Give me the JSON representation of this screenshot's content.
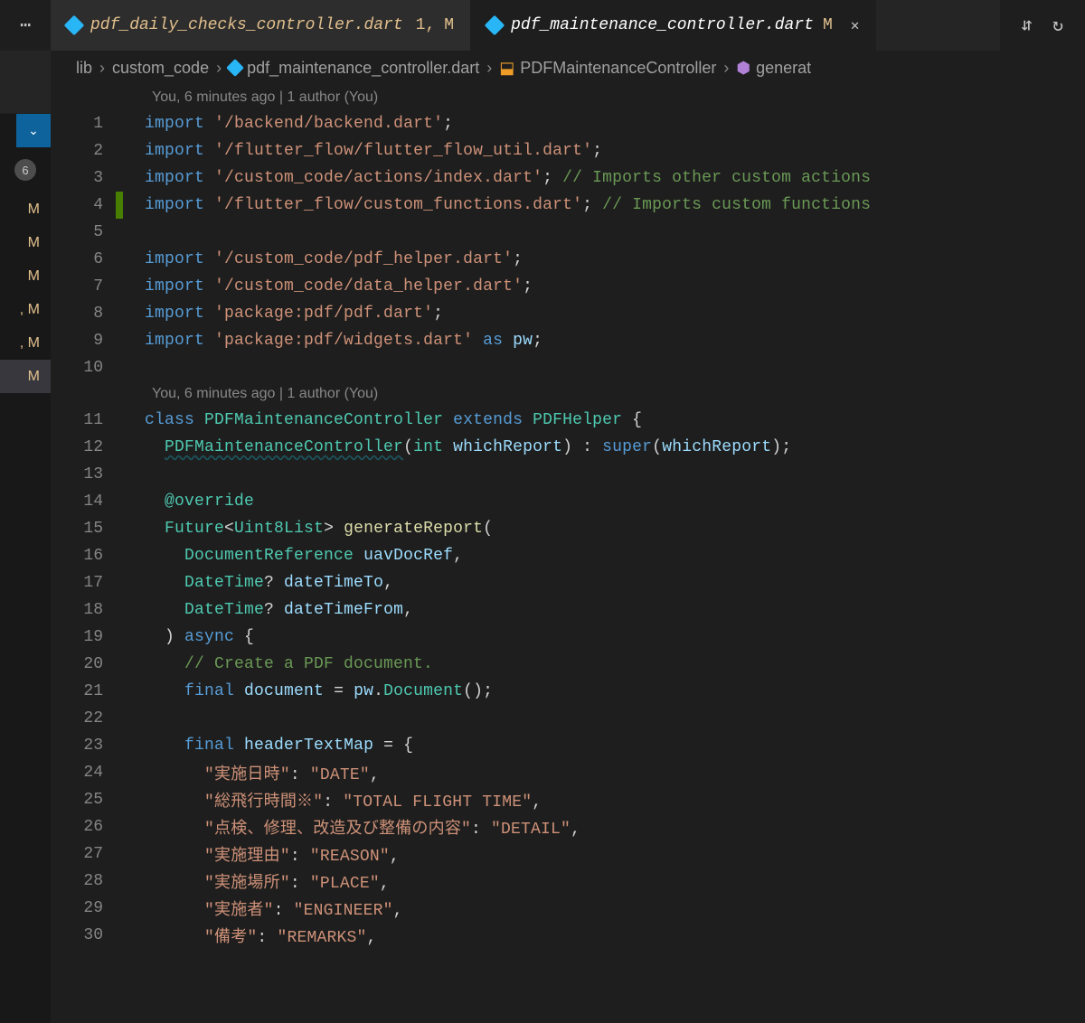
{
  "tabs": [
    {
      "name": "pdf_daily_checks_controller.dart",
      "problems": "1,",
      "modified": "M"
    },
    {
      "name": "pdf_maintenance_controller.dart",
      "modified": "M"
    }
  ],
  "breadcrumb": {
    "seg0": "lib",
    "seg1": "custom_code",
    "seg2": "pdf_maintenance_controller.dart",
    "seg3": "PDFMaintenanceController",
    "seg4": "generat"
  },
  "leftStrip": {
    "badge": "6",
    "items": [
      "M",
      "M",
      "M",
      ", M",
      ", M",
      "M"
    ]
  },
  "codelens": {
    "top": "You, 6 minutes ago | 1 author (You)",
    "mid": "You, 6 minutes ago | 1 author (You)"
  },
  "lines": [
    {
      "n": 1,
      "seg": [
        [
          "k",
          "import"
        ],
        [
          "p",
          " "
        ],
        [
          "s",
          "'/backend/backend.dart'"
        ],
        [
          "p",
          ";"
        ]
      ]
    },
    {
      "n": 2,
      "seg": [
        [
          "k",
          "import"
        ],
        [
          "p",
          " "
        ],
        [
          "s",
          "'/flutter_flow/flutter_flow_util.dart'"
        ],
        [
          "p",
          ";"
        ]
      ]
    },
    {
      "n": 3,
      "seg": [
        [
          "k",
          "import"
        ],
        [
          "p",
          " "
        ],
        [
          "s",
          "'/custom_code/actions/index.dart'"
        ],
        [
          "p",
          "; "
        ],
        [
          "c",
          "// Imports other custom actions"
        ]
      ]
    },
    {
      "n": 4,
      "mod": true,
      "seg": [
        [
          "k",
          "import"
        ],
        [
          "p",
          " "
        ],
        [
          "s",
          "'/flutter_flow/custom_functions.dart'"
        ],
        [
          "p",
          "; "
        ],
        [
          "c",
          "// Imports custom functions"
        ]
      ]
    },
    {
      "n": 5,
      "seg": []
    },
    {
      "n": 6,
      "seg": [
        [
          "k",
          "import"
        ],
        [
          "p",
          " "
        ],
        [
          "s",
          "'/custom_code/pdf_helper.dart'"
        ],
        [
          "p",
          ";"
        ]
      ]
    },
    {
      "n": 7,
      "seg": [
        [
          "k",
          "import"
        ],
        [
          "p",
          " "
        ],
        [
          "s",
          "'/custom_code/data_helper.dart'"
        ],
        [
          "p",
          ";"
        ]
      ]
    },
    {
      "n": 8,
      "seg": [
        [
          "k",
          "import"
        ],
        [
          "p",
          " "
        ],
        [
          "s",
          "'package:pdf/pdf.dart'"
        ],
        [
          "p",
          ";"
        ]
      ]
    },
    {
      "n": 9,
      "seg": [
        [
          "k",
          "import"
        ],
        [
          "p",
          " "
        ],
        [
          "s",
          "'package:pdf/widgets.dart'"
        ],
        [
          "p",
          " "
        ],
        [
          "k",
          "as"
        ],
        [
          "p",
          " "
        ],
        [
          "v",
          "pw"
        ],
        [
          "p",
          ";"
        ]
      ]
    },
    {
      "n": 10,
      "seg": []
    },
    {
      "n": 11,
      "seg": [
        [
          "k",
          "class"
        ],
        [
          "p",
          " "
        ],
        [
          "t",
          "PDFMaintenanceController"
        ],
        [
          "p",
          " "
        ],
        [
          "k",
          "extends"
        ],
        [
          "p",
          " "
        ],
        [
          "t",
          "PDFHelper"
        ],
        [
          "p",
          " {"
        ]
      ]
    },
    {
      "n": 12,
      "seg": [
        [
          "p",
          "  "
        ],
        [
          "t warn",
          "PDFMaintenanceController"
        ],
        [
          "p",
          "("
        ],
        [
          "t",
          "int"
        ],
        [
          "p",
          " "
        ],
        [
          "v",
          "whichReport"
        ],
        [
          "p",
          ") : "
        ],
        [
          "k",
          "super"
        ],
        [
          "p",
          "("
        ],
        [
          "v",
          "whichReport"
        ],
        [
          "p",
          ");"
        ]
      ]
    },
    {
      "n": 13,
      "seg": []
    },
    {
      "n": 14,
      "seg": [
        [
          "p",
          "  "
        ],
        [
          "anno",
          "@override"
        ]
      ]
    },
    {
      "n": 15,
      "seg": [
        [
          "p",
          "  "
        ],
        [
          "t",
          "Future"
        ],
        [
          "p",
          "<"
        ],
        [
          "t",
          "Uint8List"
        ],
        [
          "p",
          "> "
        ],
        [
          "f",
          "generateReport"
        ],
        [
          "p",
          "("
        ]
      ]
    },
    {
      "n": 16,
      "seg": [
        [
          "p",
          "    "
        ],
        [
          "t",
          "DocumentReference"
        ],
        [
          "p",
          " "
        ],
        [
          "v",
          "uavDocRef"
        ],
        [
          "p",
          ","
        ]
      ]
    },
    {
      "n": 17,
      "seg": [
        [
          "p",
          "    "
        ],
        [
          "t",
          "DateTime"
        ],
        [
          "p",
          "? "
        ],
        [
          "v",
          "dateTimeTo"
        ],
        [
          "p",
          ","
        ]
      ]
    },
    {
      "n": 18,
      "seg": [
        [
          "p",
          "    "
        ],
        [
          "t",
          "DateTime"
        ],
        [
          "p",
          "? "
        ],
        [
          "v",
          "dateTimeFrom"
        ],
        [
          "p",
          ","
        ]
      ]
    },
    {
      "n": 19,
      "seg": [
        [
          "p",
          "  ) "
        ],
        [
          "k",
          "async"
        ],
        [
          "p",
          " {"
        ]
      ]
    },
    {
      "n": 20,
      "seg": [
        [
          "p",
          "    "
        ],
        [
          "c",
          "// Create a PDF document."
        ]
      ]
    },
    {
      "n": 21,
      "seg": [
        [
          "p",
          "    "
        ],
        [
          "k",
          "final"
        ],
        [
          "p",
          " "
        ],
        [
          "v",
          "document"
        ],
        [
          "p",
          " = "
        ],
        [
          "v",
          "pw"
        ],
        [
          "p",
          "."
        ],
        [
          "t",
          "Document"
        ],
        [
          "p",
          "();"
        ]
      ]
    },
    {
      "n": 22,
      "seg": []
    },
    {
      "n": 23,
      "seg": [
        [
          "p",
          "    "
        ],
        [
          "k",
          "final"
        ],
        [
          "p",
          " "
        ],
        [
          "v",
          "headerTextMap"
        ],
        [
          "p",
          " = {"
        ]
      ]
    },
    {
      "n": 24,
      "seg": [
        [
          "p",
          "      "
        ],
        [
          "s",
          "\"実施日時\""
        ],
        [
          "p",
          ": "
        ],
        [
          "s",
          "\"DATE\""
        ],
        [
          "p",
          ","
        ]
      ]
    },
    {
      "n": 25,
      "seg": [
        [
          "p",
          "      "
        ],
        [
          "s",
          "\"総飛行時間※\""
        ],
        [
          "p",
          ": "
        ],
        [
          "s",
          "\"TOTAL FLIGHT TIME\""
        ],
        [
          "p",
          ","
        ]
      ]
    },
    {
      "n": 26,
      "seg": [
        [
          "p",
          "      "
        ],
        [
          "s",
          "\"点検、修理、改造及び整備の内容\""
        ],
        [
          "p",
          ": "
        ],
        [
          "s",
          "\"DETAIL\""
        ],
        [
          "p",
          ","
        ]
      ]
    },
    {
      "n": 27,
      "seg": [
        [
          "p",
          "      "
        ],
        [
          "s",
          "\"実施理由\""
        ],
        [
          "p",
          ": "
        ],
        [
          "s",
          "\"REASON\""
        ],
        [
          "p",
          ","
        ]
      ]
    },
    {
      "n": 28,
      "seg": [
        [
          "p",
          "      "
        ],
        [
          "s",
          "\"実施場所\""
        ],
        [
          "p",
          ": "
        ],
        [
          "s",
          "\"PLACE\""
        ],
        [
          "p",
          ","
        ]
      ]
    },
    {
      "n": 29,
      "seg": [
        [
          "p",
          "      "
        ],
        [
          "s",
          "\"実施者\""
        ],
        [
          "p",
          ": "
        ],
        [
          "s",
          "\"ENGINEER\""
        ],
        [
          "p",
          ","
        ]
      ]
    },
    {
      "n": 30,
      "seg": [
        [
          "p",
          "      "
        ],
        [
          "s",
          "\"備考\""
        ],
        [
          "p",
          ": "
        ],
        [
          "s",
          "\"REMARKS\""
        ],
        [
          "p",
          ","
        ]
      ]
    }
  ]
}
